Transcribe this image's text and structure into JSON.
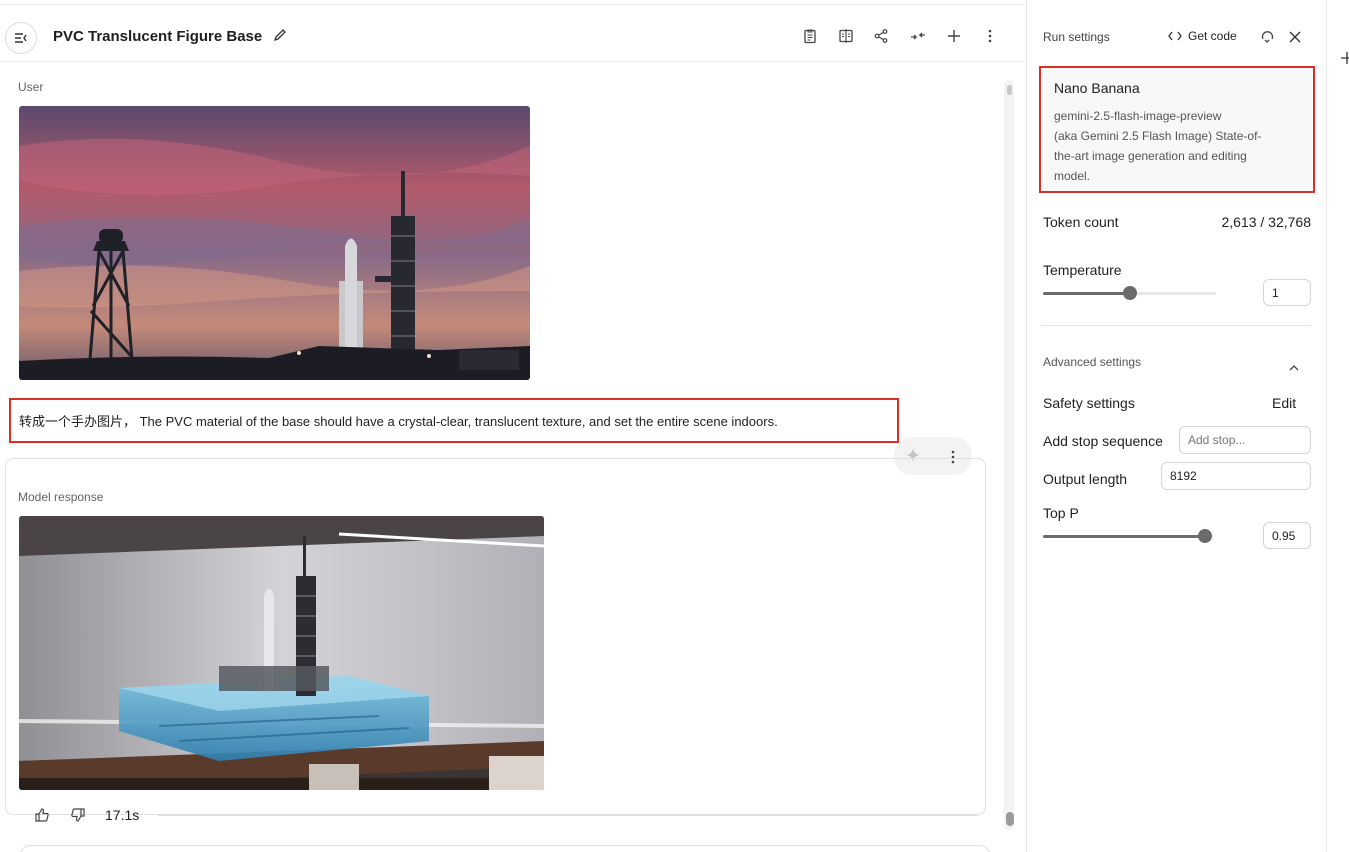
{
  "header": {
    "title": "PVC Translucent Figure Base"
  },
  "chat": {
    "user_label": "User",
    "prompt_text": "转成一个手办图片， The PVC material of the base should have a crystal-clear, translucent texture, and set the entire scene indoors.",
    "model_label": "Model response",
    "response_time": "17.1s"
  },
  "settings": {
    "title": "Run settings",
    "get_code": "Get code",
    "model": {
      "name": "Nano Banana",
      "id": "gemini-2.5-flash-image-preview",
      "description_lines": [
        "(aka Gemini 2.5 Flash Image) State-of-",
        "the-art image generation and editing",
        "model."
      ]
    },
    "token_count_label": "Token count",
    "token_count_value": "2,613 / 32,768",
    "temperature_label": "Temperature",
    "temperature_value": "1",
    "temperature_level": 0.5,
    "advanced_label": "Advanced settings",
    "safety_label": "Safety settings",
    "safety_edit": "Edit",
    "stop_sequence_label": "Add stop sequence",
    "stop_sequence_placeholder": "Add stop...",
    "output_length_label": "Output length",
    "output_length_value": "8192",
    "top_p_label": "Top P",
    "top_p_value": "0.95",
    "top_p_level": 0.95
  },
  "icons": {
    "menu": "sidebar-toggle-icon",
    "edit": "pencil-icon",
    "header": [
      "clipboard-icon",
      "compare-icon",
      "share-icon",
      "collapse-icon",
      "plus-icon",
      "more-vertical-icon"
    ],
    "response": [
      "sparkle-icon",
      "more-vertical-icon"
    ],
    "feedback": [
      "thumbs-up-icon",
      "thumbs-down-icon"
    ],
    "panel": [
      "code-icon",
      "reset-icon",
      "close-icon",
      "chevron-up-icon"
    ]
  },
  "colors": {
    "highlight": "#d93025",
    "slider": "#6b6b6b"
  }
}
